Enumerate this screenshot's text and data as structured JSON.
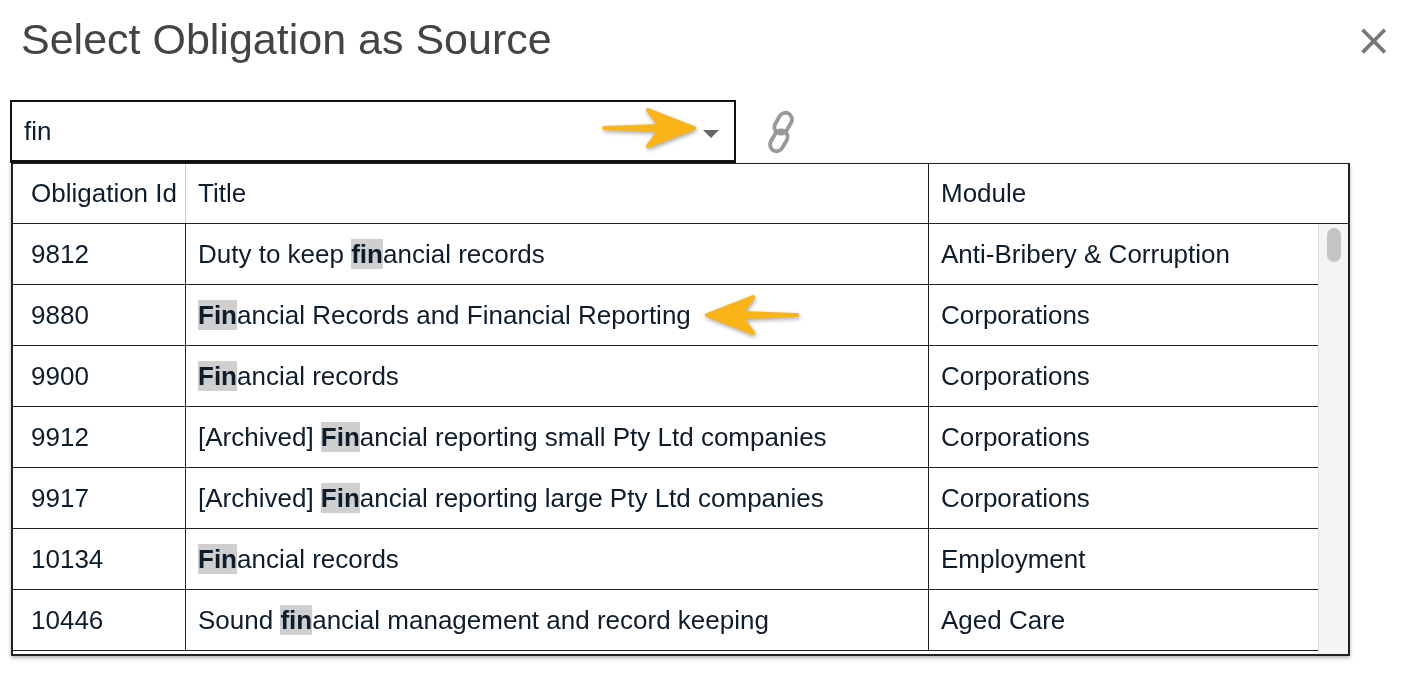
{
  "dialog": {
    "title": "Select Obligation as Source",
    "close": "×"
  },
  "search": {
    "value": "fin",
    "pointed_at": true
  },
  "table": {
    "columns": [
      "Obligation Id",
      "Title",
      "Module"
    ],
    "rows": [
      {
        "id": "9812",
        "title": "Duty to keep **fin**ancial records",
        "module": "Anti-Bribery & Corruption",
        "pointed_at": false
      },
      {
        "id": "9880",
        "title": "**Fin**ancial Records and Financial Reporting",
        "module": "Corporations",
        "pointed_at": true
      },
      {
        "id": "9900",
        "title": "**Fin**ancial records",
        "module": "Corporations",
        "pointed_at": false
      },
      {
        "id": "9912",
        "title": "[Archived] **Fin**ancial reporting small Pty Ltd companies",
        "module": "Corporations",
        "pointed_at": false
      },
      {
        "id": "9917",
        "title": "[Archived] **Fin**ancial reporting large Pty Ltd companies",
        "module": "Corporations",
        "pointed_at": false
      },
      {
        "id": "10134",
        "title": "**Fin**ancial records",
        "module": "Employment",
        "pointed_at": false
      },
      {
        "id": "10446",
        "title": "Sound **fin**ancial management and record keeping",
        "module": "Aged Care",
        "pointed_at": false
      }
    ]
  }
}
